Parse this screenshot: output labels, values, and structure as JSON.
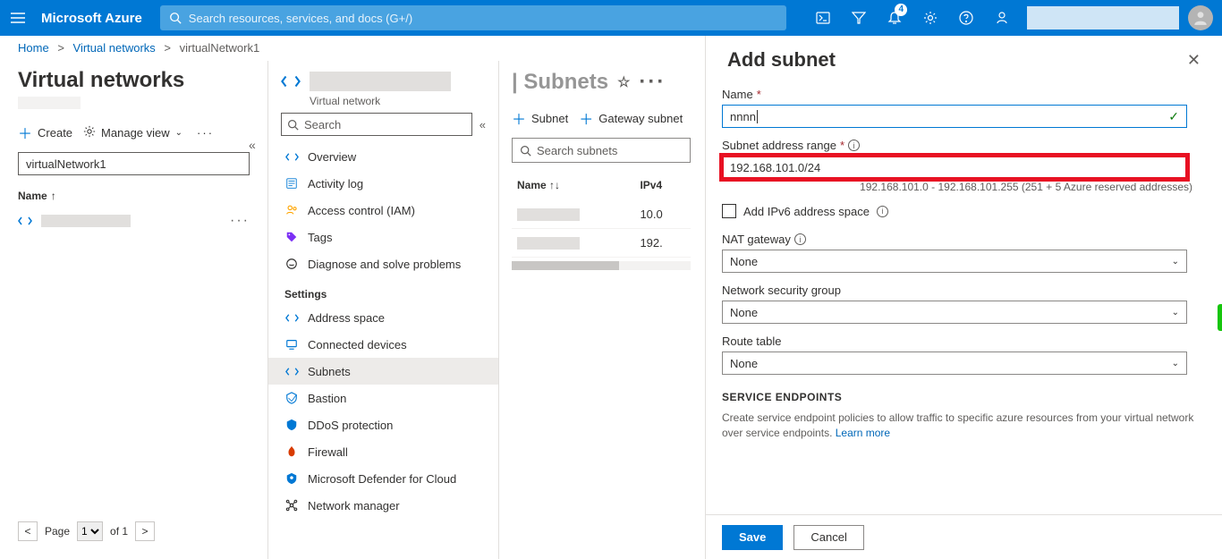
{
  "topbar": {
    "brand": "Microsoft Azure",
    "search_placeholder": "Search resources, services, and docs (G+/)",
    "notification_count": "4"
  },
  "breadcrumb": {
    "home": "Home",
    "l1": "Virtual networks",
    "l2": "virtualNetwork1"
  },
  "col1": {
    "title": "Virtual networks",
    "create": "Create",
    "manage_view": "Manage view",
    "filter_value": "virtualNetwork1",
    "col_name": "Name",
    "page_label": "Page",
    "page_value": "1",
    "page_of": "of 1"
  },
  "col2": {
    "type": "Virtual network",
    "search_placeholder": "Search",
    "items_top": [
      {
        "icon": "vnet",
        "label": "Overview"
      },
      {
        "icon": "log",
        "label": "Activity log"
      },
      {
        "icon": "iam",
        "label": "Access control (IAM)"
      },
      {
        "icon": "tag",
        "label": "Tags"
      },
      {
        "icon": "diag",
        "label": "Diagnose and solve problems"
      }
    ],
    "section_settings": "Settings",
    "items_settings": [
      {
        "icon": "vnet",
        "label": "Address space"
      },
      {
        "icon": "dev",
        "label": "Connected devices"
      },
      {
        "icon": "vnet",
        "label": "Subnets",
        "active": true
      },
      {
        "icon": "bastion",
        "label": "Bastion"
      },
      {
        "icon": "ddos",
        "label": "DDoS protection"
      },
      {
        "icon": "fw",
        "label": "Firewall"
      },
      {
        "icon": "def",
        "label": "Microsoft Defender for Cloud"
      },
      {
        "icon": "nm",
        "label": "Network manager"
      }
    ]
  },
  "col3": {
    "heading_suffix": "| Subnets",
    "cmd_subnet": "Subnet",
    "cmd_gateway": "Gateway subnet",
    "search_placeholder": "Search subnets",
    "th_name": "Name",
    "th_ipv4": "IPv4",
    "rows": [
      {
        "ipv4": "10.0"
      },
      {
        "ipv4": "192."
      }
    ]
  },
  "flyout": {
    "title": "Add subnet",
    "name_label": "Name",
    "name_value": "nnnn",
    "range_label": "Subnet address range",
    "range_value": "192.168.101.0/24",
    "range_helper": "192.168.101.0 - 192.168.101.255 (251 + 5 Azure reserved addresses)",
    "ipv6_label": "Add IPv6 address space",
    "nat_label": "NAT gateway",
    "nat_value": "None",
    "nsg_label": "Network security group",
    "nsg_value": "None",
    "rt_label": "Route table",
    "rt_value": "None",
    "endpoints_title": "SERVICE ENDPOINTS",
    "endpoints_desc": "Create service endpoint policies to allow traffic to specific azure resources from your virtual network over service endpoints. ",
    "learn_more": "Learn more",
    "save": "Save",
    "cancel": "Cancel"
  }
}
